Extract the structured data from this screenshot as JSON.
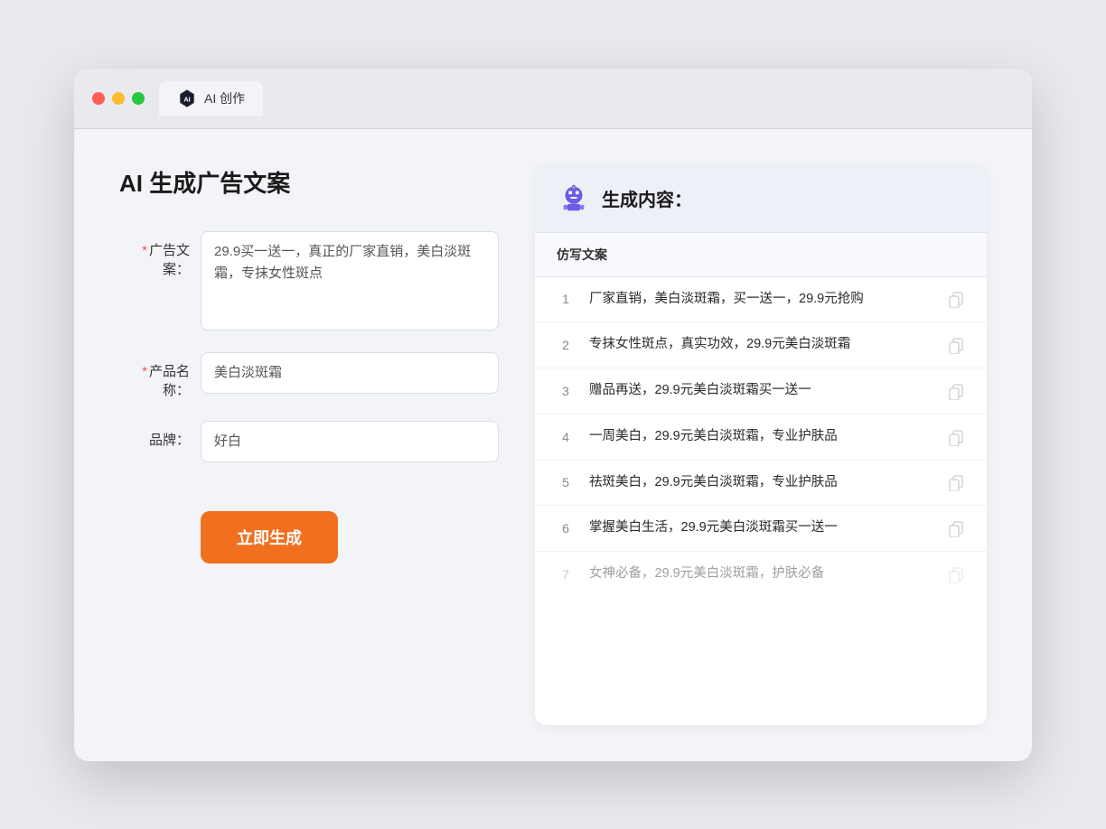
{
  "browser": {
    "tab_label": "AI 创作"
  },
  "page": {
    "title": "AI 生成广告文案"
  },
  "form": {
    "ad_copy_label": "广告文案：",
    "ad_copy_value": "29.9买一送一，真正的厂家直销，美白淡斑霜，专抹女性斑点",
    "product_name_label": "产品名称：",
    "product_name_value": "美白淡斑霜",
    "brand_label": "品牌：",
    "brand_value": "好白",
    "generate_button": "立即生成"
  },
  "results": {
    "header": "生成内容：",
    "column_label": "仿写文案",
    "items": [
      {
        "num": "1",
        "text": "厂家直销，美白淡斑霜，买一送一，29.9元抢购",
        "muted": false
      },
      {
        "num": "2",
        "text": "专抹女性斑点，真实功效，29.9元美白淡斑霜",
        "muted": false
      },
      {
        "num": "3",
        "text": "赠品再送，29.9元美白淡斑霜买一送一",
        "muted": false
      },
      {
        "num": "4",
        "text": "一周美白，29.9元美白淡斑霜，专业护肤品",
        "muted": false
      },
      {
        "num": "5",
        "text": "祛斑美白，29.9元美白淡斑霜，专业护肤品",
        "muted": false
      },
      {
        "num": "6",
        "text": "掌握美白生活，29.9元美白淡斑霜买一送一",
        "muted": false
      },
      {
        "num": "7",
        "text": "女神必备，29.9元美白淡斑霜，护肤必备",
        "muted": true
      }
    ]
  }
}
